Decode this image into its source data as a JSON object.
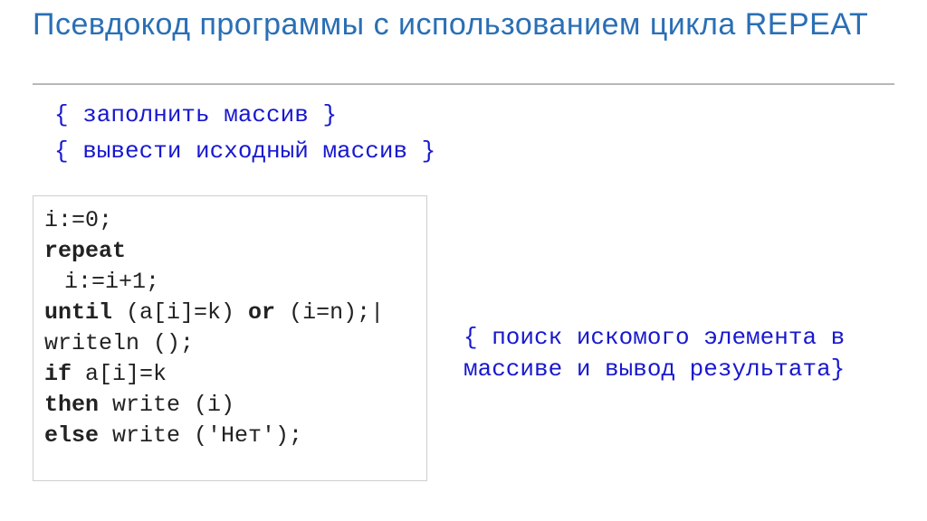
{
  "title": "Псевдокод программы с использованием цикла REPEAT",
  "comments": {
    "fill_array": "{ заполнить массив }",
    "print_array": "{ вывести исходный массив }",
    "search": "{ поиск искомого элемента в массиве и вывод результата}"
  },
  "code": {
    "l1": "i:=0;",
    "l2": "repeat",
    "l3": "i:=i+1;",
    "l4_kw": "until",
    "l4_cond1": " (a[i]=k) ",
    "l4_or": "or",
    "l4_cond2": " (i=n);",
    "l4_cursor": "|",
    "l5": "writeln ();",
    "l6_kw": "if",
    "l6_rest": " a[i]=k",
    "l7_kw": "then",
    "l7_rest": " write (i)",
    "l8_kw": "else",
    "l8_rest": " write ('Нет');"
  }
}
